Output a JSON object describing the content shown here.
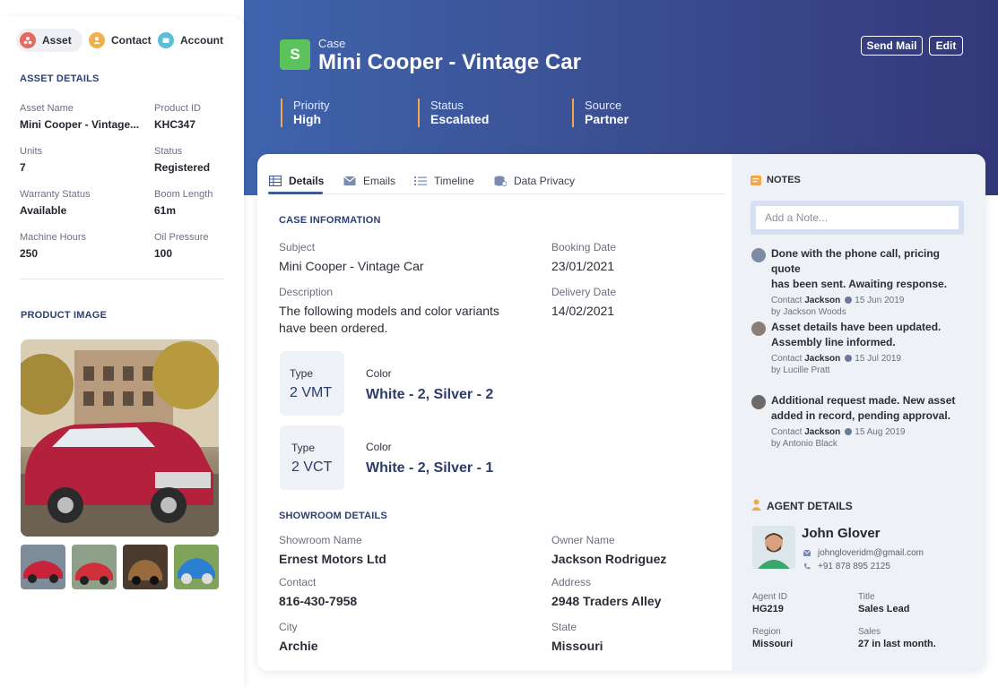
{
  "header": {
    "logo_letter": "S",
    "kicker": "Case",
    "title": "Mini Cooper - Vintage Car",
    "send_mail_label": "Send Mail",
    "edit_label": "Edit",
    "meta": [
      {
        "label": "Priority",
        "value": "High"
      },
      {
        "label": "Status",
        "value": "Escalated"
      },
      {
        "label": "Source",
        "value": "Partner"
      }
    ],
    "accent_color": "#f2a84a"
  },
  "left": {
    "pills": [
      {
        "label": "Asset",
        "color": "#e8685e",
        "active": true
      },
      {
        "label": "Contact",
        "color": "#f1b04b",
        "active": false
      },
      {
        "label": "Account",
        "color": "#5bbfd8",
        "active": false
      }
    ],
    "asset_details_title": "ASSET DETAILS",
    "fields": [
      {
        "label": "Asset Name",
        "value": "Mini Cooper - Vintage..."
      },
      {
        "label": "Product ID",
        "value": "KHC347"
      },
      {
        "label": "Units",
        "value": "7"
      },
      {
        "label": "Status",
        "value": "Registered"
      },
      {
        "label": "Warranty Status",
        "value": "Available"
      },
      {
        "label": "Boom Length",
        "value": "61m"
      },
      {
        "label": "Machine Hours",
        "value": "250"
      },
      {
        "label": "Oil Pressure",
        "value": "100"
      }
    ],
    "product_image_title": "PRODUCT IMAGE"
  },
  "tabs": [
    {
      "label": "Details",
      "icon": "table-icon"
    },
    {
      "label": "Emails",
      "icon": "envelope-icon"
    },
    {
      "label": "Timeline",
      "icon": "list-icon"
    },
    {
      "label": "Data Privacy",
      "icon": "database-icon"
    }
  ],
  "case_info": {
    "title": "CASE INFORMATION",
    "subject_label": "Subject",
    "subject": "Mini Cooper - Vintage Car",
    "booking_label": "Booking Date",
    "booking": "23/01/2021",
    "description_label": "Description",
    "description_line1": "The following models and color variants",
    "description_line2": "have been ordered.",
    "delivery_label": "Delivery Date",
    "delivery": "14/02/2021",
    "variants": [
      {
        "type_label": "Type",
        "type": "2 VMT",
        "color_label": "Color",
        "color": "White - 2, Silver - 2"
      },
      {
        "type_label": "Type",
        "type": "2 VCT",
        "color_label": "Color",
        "color": "White - 2, Silver - 1"
      }
    ]
  },
  "showroom": {
    "title": "SHOWROOM DETAILS",
    "fields": [
      {
        "label": "Showroom Name",
        "value": "Ernest Motors Ltd"
      },
      {
        "label": "Owner Name",
        "value": "Jackson Rodriguez"
      },
      {
        "label": "Contact",
        "value": "816-430-7958"
      },
      {
        "label": "Address",
        "value": "2948 Traders Alley"
      },
      {
        "label": "City",
        "value": "Archie"
      },
      {
        "label": "State",
        "value": "Missouri"
      }
    ]
  },
  "notes": {
    "title": "NOTES",
    "placeholder": "Add a Note...",
    "items": [
      {
        "line1": "Done with the phone call, pricing quote",
        "line2": "has been sent. Awaiting response.",
        "contact_prefix": "Contact",
        "contact": "Jackson",
        "date": "15 Jun 2019",
        "by": "by Jackson Woods"
      },
      {
        "line1": "Asset details have been updated.",
        "line2": "Assembly line informed.",
        "contact_prefix": "Contact",
        "contact": "Jackson",
        "date": "15 Jul 2019",
        "by": "by Lucille Pratt"
      },
      {
        "line1": "Additional request made. New asset",
        "line2": "added in record, pending approval.",
        "contact_prefix": "Contact",
        "contact": "Jackson",
        "date": "15 Aug 2019",
        "by": "by Antonio Black"
      }
    ]
  },
  "agent": {
    "title": "AGENT DETAILS",
    "name": "John Glover",
    "email": "johngloveridm@gmail.com",
    "phone": "+91 878 895 2125",
    "fields": [
      {
        "label": "Agent ID",
        "value": "HG219"
      },
      {
        "label": "Title",
        "value": "Sales Lead"
      },
      {
        "label": "Region",
        "value": "Missouri"
      },
      {
        "label": "Sales",
        "value": "27 in last month."
      }
    ]
  }
}
